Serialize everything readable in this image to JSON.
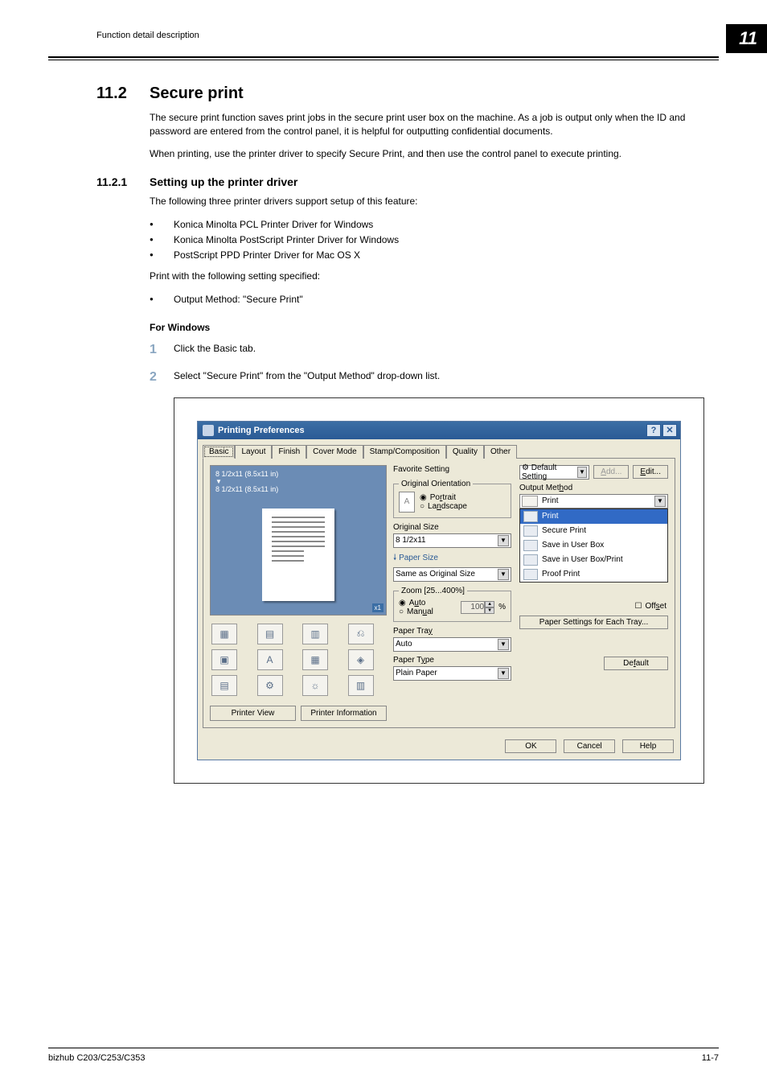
{
  "header": {
    "breadcrumb": "Function detail description",
    "chapter": "11"
  },
  "section": {
    "num": "11.2",
    "title": "Secure print",
    "para1": "The secure print function saves print jobs in the secure print user box on the machine. As a job is output only when the ID and password are entered from the control panel, it is helpful for outputting confidential documents.",
    "para2": "When printing, use the printer driver to specify Secure Print, and then use the control panel to execute printing."
  },
  "subsection": {
    "num": "11.2.1",
    "title": "Setting up the printer driver",
    "intro": "The following three printer drivers support setup of this feature:",
    "drivers": [
      "Konica Minolta PCL Printer Driver for Windows",
      "Konica Minolta PostScript Printer Driver for Windows",
      "PostScript PPD Printer Driver for Mac OS X"
    ],
    "print_with": "Print with the following setting specified:",
    "settings": [
      "Output Method: \"Secure Print\""
    ],
    "for_windows": "For Windows",
    "steps": [
      "Click the Basic tab.",
      "Select \"Secure Print\" from the \"Output Method\" drop-down list."
    ]
  },
  "dialog": {
    "title": "Printing Preferences",
    "tabs": [
      "Basic",
      "Layout",
      "Finish",
      "Cover Mode",
      "Stamp/Composition",
      "Quality",
      "Other"
    ],
    "selected_tab": "Basic",
    "preview": {
      "line1": "8 1/2x11 (8.5x11 in)",
      "line2": "8 1/2x11 (8.5x11 in)",
      "badge": "x1"
    },
    "pv_buttons": {
      "printer_view": "Printer View",
      "printer_info": "Printer Information"
    },
    "favorite": {
      "label": "Favorite Setting",
      "value": "Default Setting",
      "add": "Add...",
      "edit": "Edit..."
    },
    "orientation": {
      "legend": "Original Orientation",
      "portrait": "Portrait",
      "landscape": "Landscape"
    },
    "original_size": {
      "label": "Original Size",
      "value": "8 1/2x11"
    },
    "paper_size": {
      "label": "Paper Size",
      "value": "Same as Original Size"
    },
    "zoom": {
      "legend": "Zoom [25...400%]",
      "auto": "Auto",
      "manual": "Manual",
      "value": "100",
      "unit": "%"
    },
    "paper_tray": {
      "label": "Paper Tray",
      "value": "Auto"
    },
    "paper_type": {
      "label": "Paper Type",
      "value": "Plain Paper"
    },
    "output_method": {
      "label": "Output Method",
      "value": "Print",
      "options": [
        "Print",
        "Secure Print",
        "Save in User Box",
        "Save in User Box/Print",
        "Proof Print"
      ],
      "selected_option": "Print"
    },
    "offset": "Offset",
    "paper_settings_each": "Paper Settings for Each Tray...",
    "default": "Default",
    "footer": {
      "ok": "OK",
      "cancel": "Cancel",
      "help": "Help"
    }
  },
  "footer": {
    "model": "bizhub C203/C253/C353",
    "page": "11-7"
  }
}
